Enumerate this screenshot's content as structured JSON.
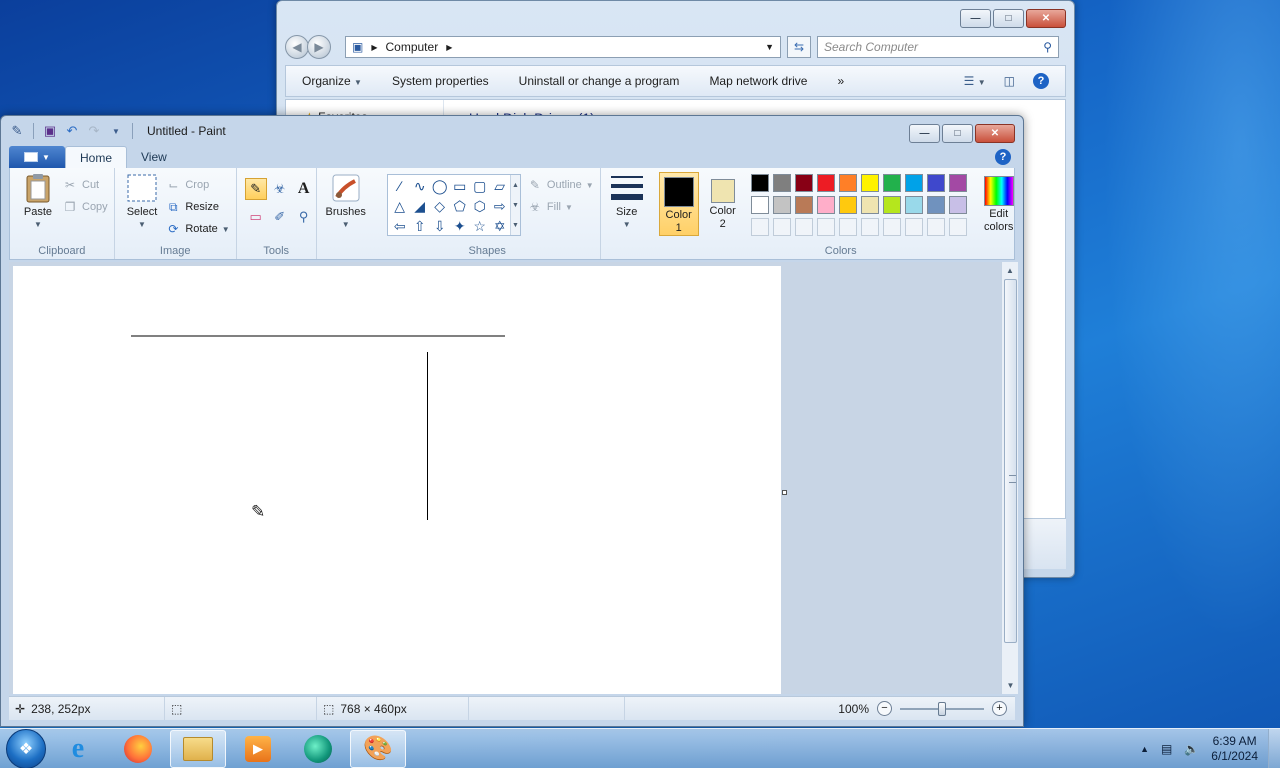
{
  "explorer": {
    "address": "Computer",
    "search_placeholder": "Search Computer",
    "commands": [
      "Organize",
      "System properties",
      "Uninstall or change a program",
      "Map network drive"
    ],
    "more": "»",
    "nav_favorites": "Favorites",
    "section_header": "Hard Disk Drives (1)"
  },
  "paint": {
    "title": "Untitled - Paint",
    "tabs": {
      "home": "Home",
      "view": "View"
    },
    "clipboard": {
      "label": "Clipboard",
      "paste": "Paste",
      "cut": "Cut",
      "copy": "Copy"
    },
    "image": {
      "label": "Image",
      "select": "Select",
      "crop": "Crop",
      "resize": "Resize",
      "rotate": "Rotate"
    },
    "tools": {
      "label": "Tools"
    },
    "brushes": "Brushes",
    "shapes": {
      "label": "Shapes",
      "outline": "Outline",
      "fill": "Fill"
    },
    "size": "Size",
    "colors": {
      "label": "Colors",
      "color1_line1": "Color",
      "color1_line2": "1",
      "color2_line1": "Color",
      "color2_line2": "2",
      "edit_line1": "Edit",
      "edit_line2": "colors",
      "color1_value": "#000000",
      "color2_value": "#efe4b0",
      "palette_row1": [
        "#000000",
        "#7f7f7f",
        "#880015",
        "#ed1c24",
        "#ff7f27",
        "#fff200",
        "#22b14c",
        "#00a2e8",
        "#3f48cc",
        "#a349a4"
      ],
      "palette_row2": [
        "#ffffff",
        "#c3c3c3",
        "#b97a57",
        "#ffaec9",
        "#ffc90e",
        "#efe4b0",
        "#b5e61d",
        "#99d9ea",
        "#7092be",
        "#c8bfe7"
      ]
    },
    "status": {
      "cursor_pos": "238, 252px",
      "canvas_size": "768 × 460px",
      "zoom": "100%"
    }
  },
  "taskbar": {
    "time": "6:39 AM",
    "date": "6/1/2024"
  }
}
